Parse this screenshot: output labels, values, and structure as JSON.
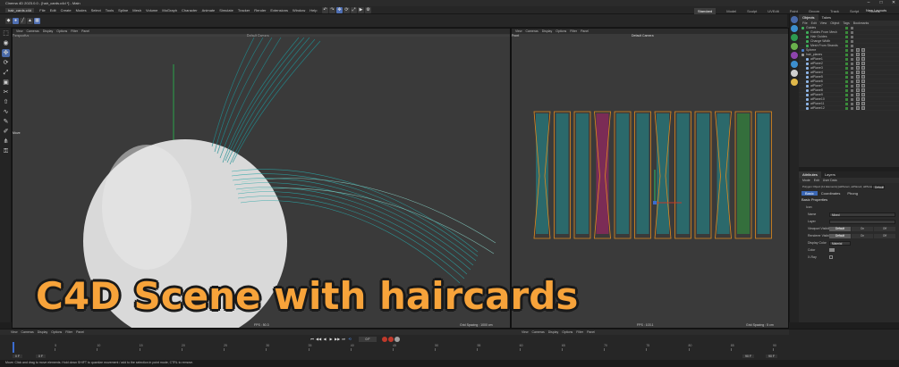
{
  "window": {
    "title": "Cinema 4D 2023.0.0 - [hair_cards.c4d *] - Main",
    "controls": [
      "–",
      "□",
      "✕"
    ]
  },
  "menu": {
    "items": [
      "File",
      "Edit",
      "Create",
      "Modes",
      "Select",
      "Tools",
      "Spline",
      "Mesh",
      "Volume",
      "MoGraph",
      "Character",
      "Animate",
      "Simulate",
      "Tracker",
      "Render",
      "Extensions",
      "Window",
      "Help"
    ],
    "tab_filename": "hair_cards.c4d"
  },
  "layouts": {
    "items": [
      "Standard",
      "Model",
      "Sculpt",
      "UVEdit",
      "Paint",
      "Groom",
      "Track",
      "Script",
      "Nodes"
    ],
    "active": "Standard",
    "new_layouts": "New Layouts"
  },
  "viewport_left": {
    "menu": [
      "View",
      "Cameras",
      "Display",
      "Options",
      "Filter",
      "Panel"
    ],
    "projection": "Perspective",
    "camera": "Default Camera",
    "move_label": "Move",
    "fps": "FPS : 50.3",
    "grid": "Grid Spacing : 1000 cm"
  },
  "viewport_right": {
    "menu": [
      "View",
      "Cameras",
      "Display",
      "Options",
      "Filter",
      "Panel"
    ],
    "projection": "Front",
    "camera": "Default Camera",
    "fps": "FPS : 103.1",
    "grid": "Grid Spacing : 5 cm"
  },
  "viewport_bottom_left": {
    "menu": [
      "View",
      "Cameras",
      "Display",
      "Options",
      "Filter",
      "Panel"
    ],
    "grid": "Grid Spacing : 1000 cm"
  },
  "viewport_bottom_right": {
    "menu": [
      "View",
      "Cameras",
      "Display",
      "Options",
      "Filter",
      "Panel"
    ],
    "grid": "Grid Spacing : 1000 cm"
  },
  "objects_panel": {
    "tabs": [
      "Objects",
      "Takes"
    ],
    "menu": [
      "File",
      "Edit",
      "View",
      "Object",
      "Tags",
      "Bookmarks"
    ],
    "rows": [
      {
        "name": "Guides",
        "indent": 0
      },
      {
        "name": "Guides From Mesh",
        "indent": 1
      },
      {
        "name": "Hair Guides",
        "indent": 1
      },
      {
        "name": "Change Width",
        "indent": 1
      },
      {
        "name": "Mesh From Strands",
        "indent": 1
      },
      {
        "name": "Sphere",
        "indent": 0
      },
      {
        "name": "hair_planes",
        "indent": 0
      },
      {
        "name": "atPlane1",
        "indent": 1
      },
      {
        "name": "atPlane2",
        "indent": 1
      },
      {
        "name": "atPlane3",
        "indent": 1
      },
      {
        "name": "atPlane4",
        "indent": 1
      },
      {
        "name": "atPlane5",
        "indent": 1
      },
      {
        "name": "atPlane6",
        "indent": 1
      },
      {
        "name": "atPlane7",
        "indent": 1
      },
      {
        "name": "atPlane8",
        "indent": 1
      },
      {
        "name": "atPlane9",
        "indent": 1
      },
      {
        "name": "atPlane10",
        "indent": 1
      },
      {
        "name": "atPlane11",
        "indent": 1
      },
      {
        "name": "atPlane12",
        "indent": 1
      }
    ]
  },
  "attributes_panel": {
    "tabs": [
      "Attributes",
      "Layers"
    ],
    "menu": [
      "Mode",
      "Edit",
      "User Data"
    ],
    "object_line": "Polygon Object [11 Elements] [atPlane1, atPlane2, atPlane3, ...]",
    "mode_value": "Default",
    "subtabs": [
      "Basic",
      "Coordinates",
      "Phong"
    ],
    "section": "Basic Properties",
    "subsection": "Icon",
    "fields": [
      {
        "label": "Name",
        "value": "Mixed"
      },
      {
        "label": "Layer",
        "value": ""
      },
      {
        "label": "Viewport Visibility",
        "options": [
          "Default",
          "On",
          "Off"
        ]
      },
      {
        "label": "Renderer Visibility",
        "options": [
          "Default",
          "On",
          "Off"
        ]
      },
      {
        "label": "Display Color",
        "value": "Material"
      },
      {
        "label": "Color",
        "value": ""
      },
      {
        "label": "X-Ray",
        "value": ""
      }
    ]
  },
  "timeline": {
    "start": "0 F",
    "end": "90 F",
    "current": "0 F",
    "frame_field": "0 F",
    "ruler": [
      "0",
      "5",
      "10",
      "15",
      "20",
      "25",
      "30",
      "35",
      "40",
      "45",
      "50",
      "55",
      "60",
      "65",
      "70",
      "75",
      "80",
      "85",
      "90"
    ],
    "playback": [
      "⏮",
      "◀◀",
      "◀",
      "▶",
      "▶▶",
      "⏭"
    ]
  },
  "status": {
    "text": "Move: Click and drag to move elements. Hold down SHIFT to quantize movement / add to the selection in point mode, CTRL to remove."
  },
  "caption": {
    "text": "C4D Scene with haircards"
  },
  "colors": {
    "hair_teal": "#1f8f93",
    "hair_magenta": "#b0206e",
    "hair_green": "#2f9a3e",
    "card_outline": "#e08a1e",
    "caption": "#f7a33a"
  }
}
